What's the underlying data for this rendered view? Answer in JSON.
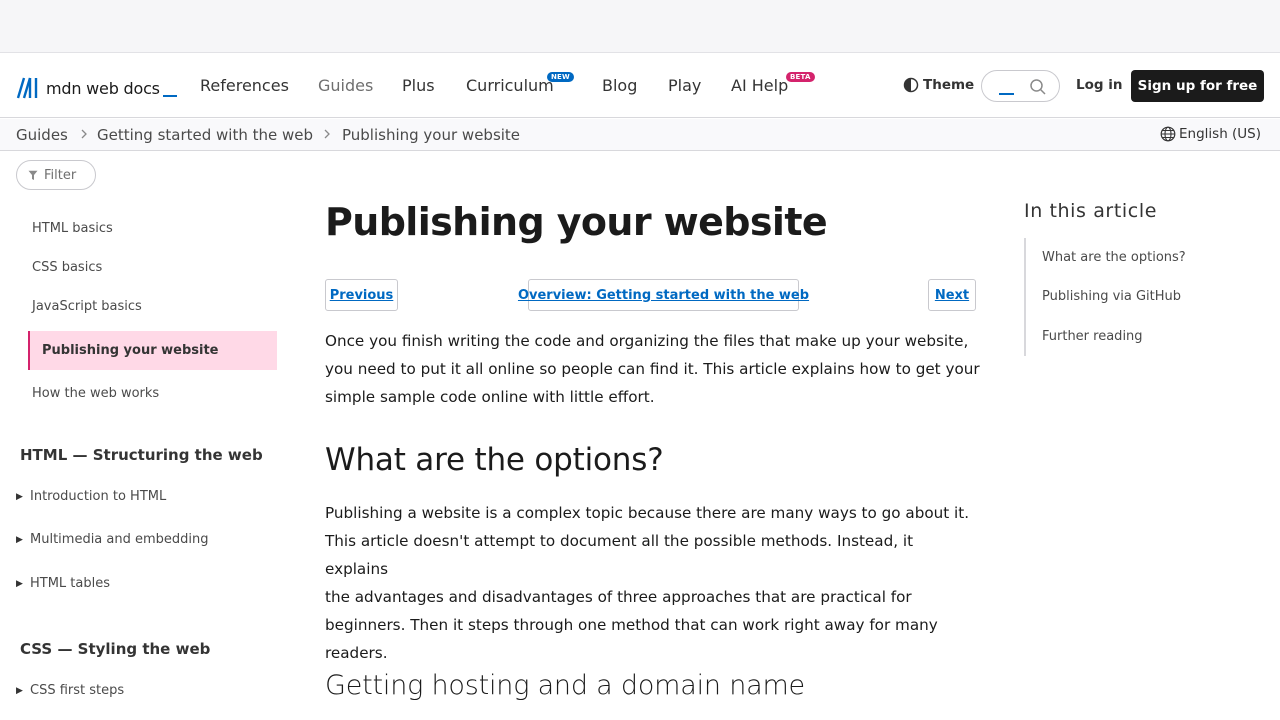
{
  "header": {
    "logo_text": "mdn web docs",
    "nav": [
      {
        "label": "References"
      },
      {
        "label": "Guides"
      },
      {
        "label": "Plus"
      },
      {
        "label": "Curriculum",
        "badge": "NEW"
      },
      {
        "label": "Blog"
      },
      {
        "label": "Play"
      },
      {
        "label": "AI Help",
        "badge": "BETA"
      }
    ],
    "theme_label": "Theme",
    "login_label": "Log in",
    "signup_label": "Sign up for free"
  },
  "breadcrumb": {
    "items": [
      "Guides",
      "Getting started with the web",
      "Publishing your website"
    ],
    "language": "English (US)"
  },
  "sidebar": {
    "filter_label": "Filter",
    "links": [
      "HTML basics",
      "CSS basics",
      "JavaScript basics",
      "Publishing your website",
      "How the web works"
    ],
    "active_link": "Publishing your website",
    "sections": [
      {
        "title": "HTML — Structuring the web",
        "items": [
          "Introduction to HTML",
          "Multimedia and embedding",
          "HTML tables"
        ]
      },
      {
        "title": "CSS — Styling the web",
        "items": [
          "CSS first steps"
        ]
      }
    ]
  },
  "article": {
    "title": "Publishing your website",
    "pager": {
      "previous": "Previous",
      "overview": "Overview: Getting started with the web",
      "next": "Next"
    },
    "intro_lines": [
      "Once you finish writing the code and organizing the files that make up your website,",
      "you need to put it all online so people can find it. This article explains how to get your",
      "simple sample code online with little effort."
    ],
    "h2": "What are the options?",
    "options_lines": [
      "Publishing a website is a complex topic because there are many ways to go about it.",
      "This article doesn't attempt to document all the possible methods. Instead, it explains",
      "the advantages and disadvantages of three approaches that are practical for",
      "beginners. Then it steps through one method that can work right away for many",
      "readers."
    ],
    "h3": "Getting hosting and a domain name"
  },
  "toc": {
    "title": "In this article",
    "items": [
      "What are the options?",
      "Publishing via GitHub",
      "Further reading"
    ]
  },
  "colors": {
    "accent": "#0069c2",
    "active_bg": "#ffd9e7",
    "beta": "#d4236c"
  },
  "icons": [
    "mdn-logo-icon",
    "theme-icon",
    "search-icon",
    "chevron-right-icon",
    "globe-icon",
    "filter-icon",
    "triangle-right-icon"
  ]
}
